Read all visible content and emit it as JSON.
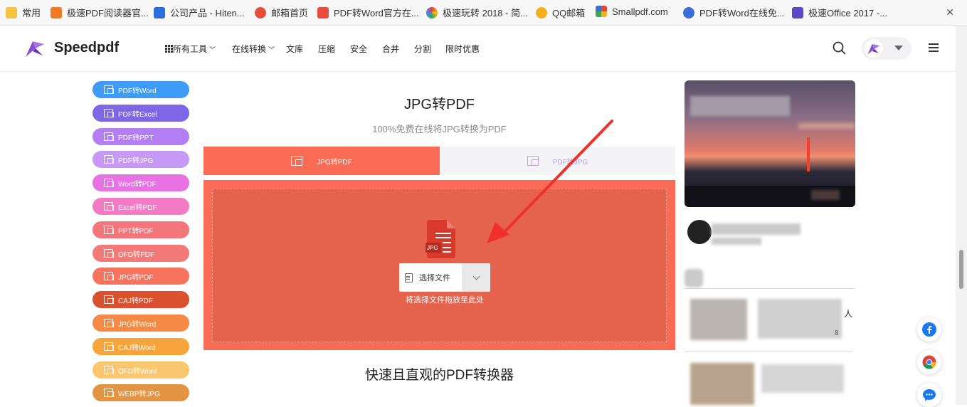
{
  "bookmarks": [
    {
      "label": "常用",
      "color": "#f5c342"
    },
    {
      "label": "极速PDF阅读器官...",
      "color": "#f27a24"
    },
    {
      "label": "公司产品 - Hiten...",
      "color": "#2a6fdb"
    },
    {
      "label": "邮箱首页",
      "color": "#e84c3d"
    },
    {
      "label": "PDF转Word官方在...",
      "color": "#e94b3c"
    },
    {
      "label": "极速玩转 2018 - 简...",
      "color": "#3aa757"
    },
    {
      "label": "QQ邮箱",
      "color": "#f6b01e"
    },
    {
      "label": "Smallpdf.com",
      "color": "#e8452f"
    },
    {
      "label": "PDF转Word在线免...",
      "color": "#3b6fd8"
    },
    {
      "label": "极速Office 2017 -...",
      "color": "#5b4ac4"
    }
  ],
  "header": {
    "logo_text": "Speedpdf",
    "nav": [
      "所有工具",
      "在线转换",
      "文库",
      "压缩",
      "安全",
      "合并",
      "分割",
      "限时优惠"
    ]
  },
  "sidebar": {
    "tools": [
      {
        "label": "PDF转Word",
        "color": "#3e9bf7"
      },
      {
        "label": "PDF转Excel",
        "color": "#7d67e6"
      },
      {
        "label": "PDF转PPT",
        "color": "#b37ef2"
      },
      {
        "label": "PDF转JPG",
        "color": "#c69af4"
      },
      {
        "label": "Word转PDF",
        "color": "#e672e4"
      },
      {
        "label": "Excel转PDF",
        "color": "#f27bc4"
      },
      {
        "label": "PPT转PDF",
        "color": "#f3767c"
      },
      {
        "label": "OFD转PDF",
        "color": "#f47a78"
      },
      {
        "label": "JPG转PDF",
        "color": "#f8735e"
      },
      {
        "label": "CAJ转PDF",
        "color": "#d9512f"
      },
      {
        "label": "JPG转Word",
        "color": "#f68a44"
      },
      {
        "label": "CAJ转Word",
        "color": "#f8a43c"
      },
      {
        "label": "OFD转Word",
        "color": "#fbc76e"
      },
      {
        "label": "WEBP转JPG",
        "color": "#e39442"
      }
    ]
  },
  "main": {
    "title": "JPG转PDF",
    "subtitle": "100%免费在线将JPG转换为PDF",
    "tab_active": "JPG转PDF",
    "tab_inactive": "PDF转JPG",
    "file_badge": "JPG",
    "choose_button": "选择文件",
    "drop_hint": "将选择文件拖放至此处",
    "section_title": "快速且直观的PDF转换器"
  },
  "right": {
    "partial_text_1": "人",
    "partial_text_2": "8"
  },
  "floating": [
    "facebook-icon",
    "chrome-icon",
    "chat-icon"
  ]
}
